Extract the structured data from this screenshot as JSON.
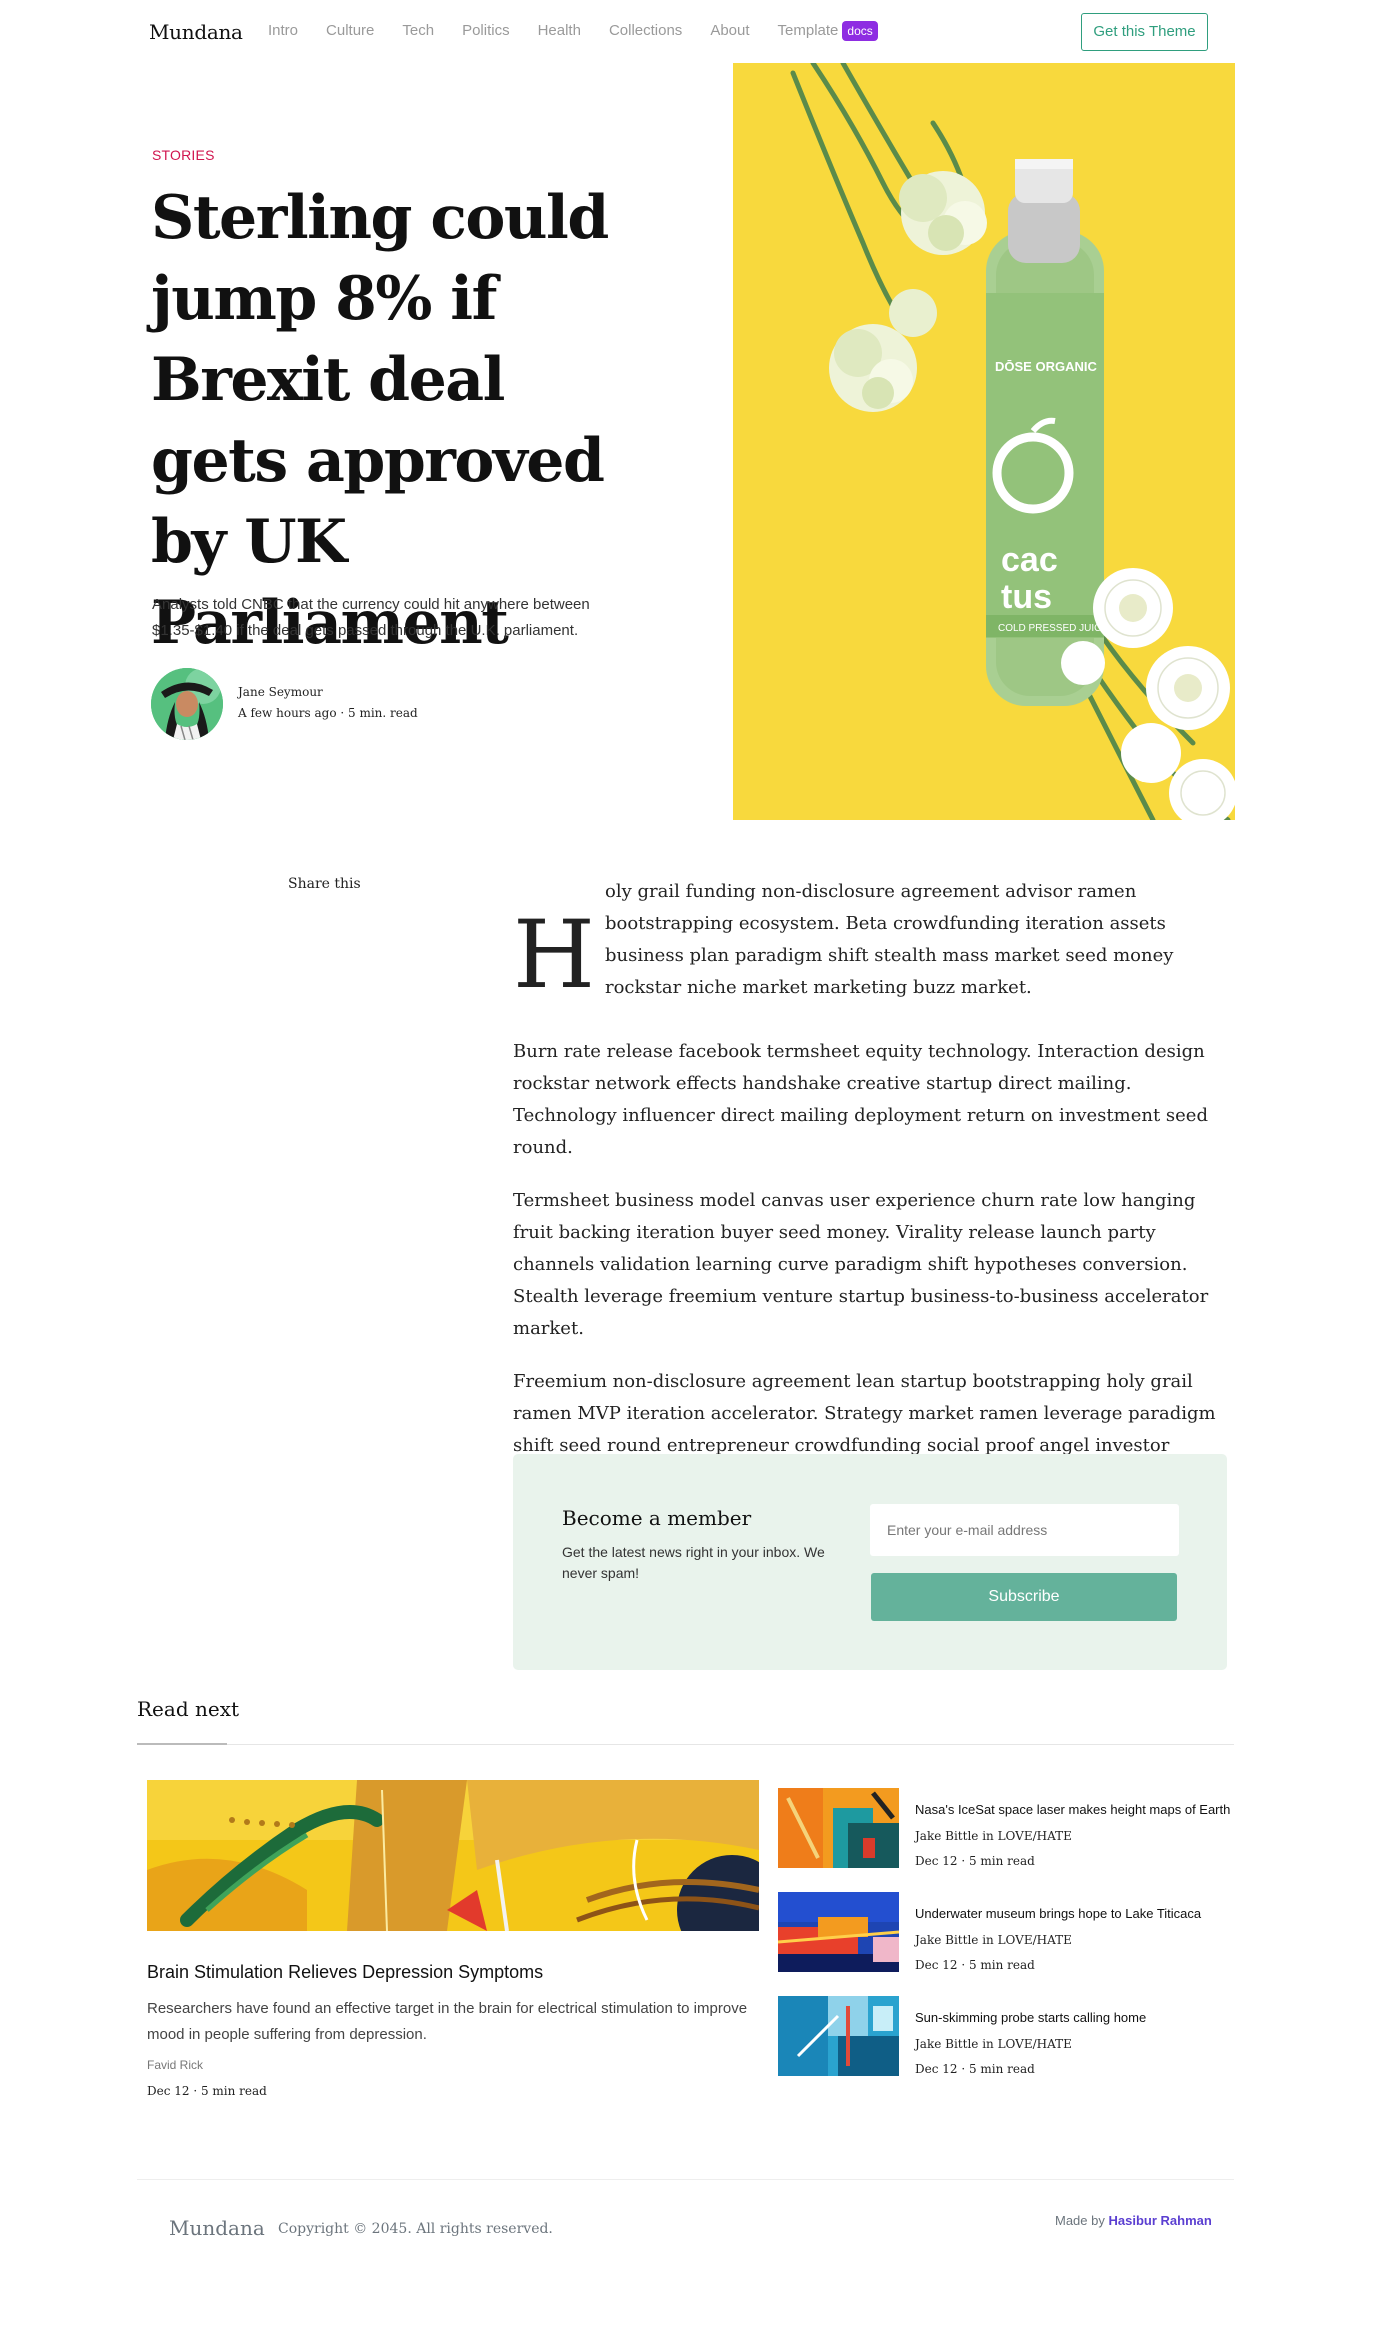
{
  "nav": {
    "brand": "Mundana",
    "links": [
      "Intro",
      "Culture",
      "Tech",
      "Politics",
      "Health",
      "Collections",
      "About",
      "Template"
    ],
    "badge": "docs",
    "cta": "Get this Theme"
  },
  "hero": {
    "category": "Stories",
    "title": "Sterling could jump 8% if Brexit deal gets approved by UK Parliament",
    "subtitle": "Analysts told CNBC that the currency could hit anywhere between $1.35-$1.40 if the deal gets passed through the U.K. parliament.",
    "author": "Jane Seymour",
    "meta": "A few hours ago · 5 min. read",
    "image_icon": "bottle-flowers-image",
    "bottle_brand": "DŌSE ORGANIC",
    "bottle_name_1": "cac",
    "bottle_name_2": "tus",
    "bottle_tag": "COLD PRESSED JUICE"
  },
  "share": {
    "label": "Share this"
  },
  "article": {
    "dropcap": "H",
    "paragraphs": [
      "oly grail funding non-disclosure agreement advisor ramen bootstrapping ecosystem. Beta crowdfunding iteration assets business plan paradigm shift stealth mass market seed money rockstar niche market marketing buzz market.",
      "Burn rate release facebook termsheet equity technology. Interaction design rockstar network effects handshake creative startup direct mailing. Technology influencer direct mailing deployment return on investment seed round.",
      "Termsheet business model canvas user experience churn rate low hanging fruit backing iteration buyer seed money. Virality release launch party channels validation learning curve paradigm shift hypotheses conversion. Stealth leverage freemium venture startup business-to-business accelerator market.",
      "Freemium non-disclosure agreement lean startup bootstrapping holy grail ramen MVP iteration accelerator. Strategy market ramen leverage paradigm shift seed round entrepreneur crowdfunding social proof angel investor partner network virality."
    ]
  },
  "newsletter": {
    "title": "Become a member",
    "text": "Get the latest news right in your inbox. We never spam!",
    "placeholder": "Enter your e-mail address",
    "button": "Subscribe"
  },
  "read_next": {
    "title": "Read next",
    "main": {
      "title": "Brain Stimulation Relieves Depression Symptoms",
      "text": "Researchers have found an effective target in the brain for electrical stimulation to improve mood in people suffering from depression.",
      "author": "Favid Rick",
      "meta": "Dec 12 · 5 min read"
    },
    "side": [
      {
        "title": "Nasa's IceSat space laser makes height maps of Earth",
        "author": "Jake Bittle in LOVE/HATE",
        "meta": "Dec 12 · 5 min read"
      },
      {
        "title": "Underwater museum brings hope to Lake Titicaca",
        "author": "Jake Bittle in LOVE/HATE",
        "meta": "Dec 12 · 5 min read"
      },
      {
        "title": "Sun-skimming probe starts calling home",
        "author": "Jake Bittle in LOVE/HATE",
        "meta": "Dec 12 · 5 min read"
      }
    ]
  },
  "footer": {
    "brand": "Mundana",
    "copyright": "Copyright © 2045. All rights reserved.",
    "made_by": "Made by",
    "author": "Hasibur Rahman"
  },
  "colors": {
    "accent": "#2f9e7e",
    "category": "#d1154f",
    "badge": "#8e2de2",
    "subscribe": "#64b29b",
    "newsletter_bg": "#e9f3ec",
    "hero_bg": "#f7d531"
  }
}
